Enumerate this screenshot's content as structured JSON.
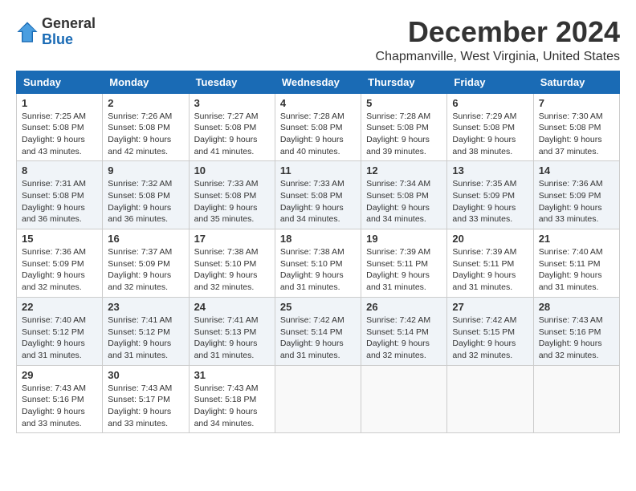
{
  "header": {
    "logo_line1": "General",
    "logo_line2": "Blue",
    "month": "December 2024",
    "location": "Chapmanville, West Virginia, United States"
  },
  "weekdays": [
    "Sunday",
    "Monday",
    "Tuesday",
    "Wednesday",
    "Thursday",
    "Friday",
    "Saturday"
  ],
  "weeks": [
    [
      {
        "day": "1",
        "sunrise": "Sunrise: 7:25 AM",
        "sunset": "Sunset: 5:08 PM",
        "daylight": "Daylight: 9 hours and 43 minutes."
      },
      {
        "day": "2",
        "sunrise": "Sunrise: 7:26 AM",
        "sunset": "Sunset: 5:08 PM",
        "daylight": "Daylight: 9 hours and 42 minutes."
      },
      {
        "day": "3",
        "sunrise": "Sunrise: 7:27 AM",
        "sunset": "Sunset: 5:08 PM",
        "daylight": "Daylight: 9 hours and 41 minutes."
      },
      {
        "day": "4",
        "sunrise": "Sunrise: 7:28 AM",
        "sunset": "Sunset: 5:08 PM",
        "daylight": "Daylight: 9 hours and 40 minutes."
      },
      {
        "day": "5",
        "sunrise": "Sunrise: 7:28 AM",
        "sunset": "Sunset: 5:08 PM",
        "daylight": "Daylight: 9 hours and 39 minutes."
      },
      {
        "day": "6",
        "sunrise": "Sunrise: 7:29 AM",
        "sunset": "Sunset: 5:08 PM",
        "daylight": "Daylight: 9 hours and 38 minutes."
      },
      {
        "day": "7",
        "sunrise": "Sunrise: 7:30 AM",
        "sunset": "Sunset: 5:08 PM",
        "daylight": "Daylight: 9 hours and 37 minutes."
      }
    ],
    [
      {
        "day": "8",
        "sunrise": "Sunrise: 7:31 AM",
        "sunset": "Sunset: 5:08 PM",
        "daylight": "Daylight: 9 hours and 36 minutes."
      },
      {
        "day": "9",
        "sunrise": "Sunrise: 7:32 AM",
        "sunset": "Sunset: 5:08 PM",
        "daylight": "Daylight: 9 hours and 36 minutes."
      },
      {
        "day": "10",
        "sunrise": "Sunrise: 7:33 AM",
        "sunset": "Sunset: 5:08 PM",
        "daylight": "Daylight: 9 hours and 35 minutes."
      },
      {
        "day": "11",
        "sunrise": "Sunrise: 7:33 AM",
        "sunset": "Sunset: 5:08 PM",
        "daylight": "Daylight: 9 hours and 34 minutes."
      },
      {
        "day": "12",
        "sunrise": "Sunrise: 7:34 AM",
        "sunset": "Sunset: 5:08 PM",
        "daylight": "Daylight: 9 hours and 34 minutes."
      },
      {
        "day": "13",
        "sunrise": "Sunrise: 7:35 AM",
        "sunset": "Sunset: 5:09 PM",
        "daylight": "Daylight: 9 hours and 33 minutes."
      },
      {
        "day": "14",
        "sunrise": "Sunrise: 7:36 AM",
        "sunset": "Sunset: 5:09 PM",
        "daylight": "Daylight: 9 hours and 33 minutes."
      }
    ],
    [
      {
        "day": "15",
        "sunrise": "Sunrise: 7:36 AM",
        "sunset": "Sunset: 5:09 PM",
        "daylight": "Daylight: 9 hours and 32 minutes."
      },
      {
        "day": "16",
        "sunrise": "Sunrise: 7:37 AM",
        "sunset": "Sunset: 5:09 PM",
        "daylight": "Daylight: 9 hours and 32 minutes."
      },
      {
        "day": "17",
        "sunrise": "Sunrise: 7:38 AM",
        "sunset": "Sunset: 5:10 PM",
        "daylight": "Daylight: 9 hours and 32 minutes."
      },
      {
        "day": "18",
        "sunrise": "Sunrise: 7:38 AM",
        "sunset": "Sunset: 5:10 PM",
        "daylight": "Daylight: 9 hours and 31 minutes."
      },
      {
        "day": "19",
        "sunrise": "Sunrise: 7:39 AM",
        "sunset": "Sunset: 5:11 PM",
        "daylight": "Daylight: 9 hours and 31 minutes."
      },
      {
        "day": "20",
        "sunrise": "Sunrise: 7:39 AM",
        "sunset": "Sunset: 5:11 PM",
        "daylight": "Daylight: 9 hours and 31 minutes."
      },
      {
        "day": "21",
        "sunrise": "Sunrise: 7:40 AM",
        "sunset": "Sunset: 5:11 PM",
        "daylight": "Daylight: 9 hours and 31 minutes."
      }
    ],
    [
      {
        "day": "22",
        "sunrise": "Sunrise: 7:40 AM",
        "sunset": "Sunset: 5:12 PM",
        "daylight": "Daylight: 9 hours and 31 minutes."
      },
      {
        "day": "23",
        "sunrise": "Sunrise: 7:41 AM",
        "sunset": "Sunset: 5:12 PM",
        "daylight": "Daylight: 9 hours and 31 minutes."
      },
      {
        "day": "24",
        "sunrise": "Sunrise: 7:41 AM",
        "sunset": "Sunset: 5:13 PM",
        "daylight": "Daylight: 9 hours and 31 minutes."
      },
      {
        "day": "25",
        "sunrise": "Sunrise: 7:42 AM",
        "sunset": "Sunset: 5:14 PM",
        "daylight": "Daylight: 9 hours and 31 minutes."
      },
      {
        "day": "26",
        "sunrise": "Sunrise: 7:42 AM",
        "sunset": "Sunset: 5:14 PM",
        "daylight": "Daylight: 9 hours and 32 minutes."
      },
      {
        "day": "27",
        "sunrise": "Sunrise: 7:42 AM",
        "sunset": "Sunset: 5:15 PM",
        "daylight": "Daylight: 9 hours and 32 minutes."
      },
      {
        "day": "28",
        "sunrise": "Sunrise: 7:43 AM",
        "sunset": "Sunset: 5:16 PM",
        "daylight": "Daylight: 9 hours and 32 minutes."
      }
    ],
    [
      {
        "day": "29",
        "sunrise": "Sunrise: 7:43 AM",
        "sunset": "Sunset: 5:16 PM",
        "daylight": "Daylight: 9 hours and 33 minutes."
      },
      {
        "day": "30",
        "sunrise": "Sunrise: 7:43 AM",
        "sunset": "Sunset: 5:17 PM",
        "daylight": "Daylight: 9 hours and 33 minutes."
      },
      {
        "day": "31",
        "sunrise": "Sunrise: 7:43 AM",
        "sunset": "Sunset: 5:18 PM",
        "daylight": "Daylight: 9 hours and 34 minutes."
      },
      null,
      null,
      null,
      null
    ]
  ]
}
